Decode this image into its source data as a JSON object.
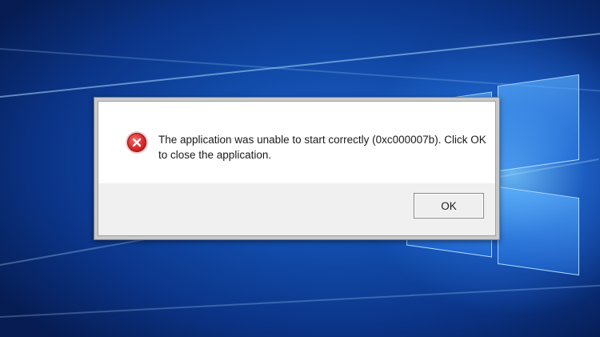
{
  "dialog": {
    "icon": "error-icon",
    "message": "The application was unable to start correctly (0xc000007b). Click OK to close the application.",
    "ok_label": "OK"
  },
  "colors": {
    "desktop_blue": "#114aa8",
    "error_red": "#d92b2b",
    "dialog_bg": "#ffffff",
    "button_bar_bg": "#f0f0f0"
  }
}
